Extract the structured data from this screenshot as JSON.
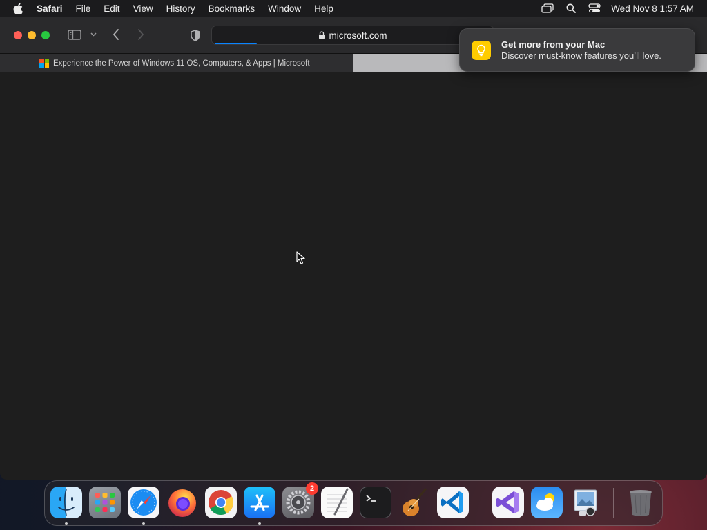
{
  "menubar": {
    "app_name": "Safari",
    "items": [
      "File",
      "Edit",
      "View",
      "History",
      "Bookmarks",
      "Window",
      "Help"
    ],
    "clock": "Wed Nov 8  1:57 AM"
  },
  "browser": {
    "url": "microsoft.com",
    "tab_title": "Experience the Power of Windows 11 OS, Computers, & Apps | Microsoft",
    "load_progress": 0.15
  },
  "notification": {
    "title": "Get more from your Mac",
    "body": "Discover must-know features you’ll love."
  },
  "dock": {
    "apps": [
      {
        "name": "Finder",
        "icon": "finder-icon",
        "running": true
      },
      {
        "name": "Launchpad",
        "icon": "launchpad-icon",
        "running": false
      },
      {
        "name": "Safari",
        "icon": "safari-icon",
        "running": true
      },
      {
        "name": "Firefox",
        "icon": "firefox-icon",
        "running": false
      },
      {
        "name": "Google Chrome",
        "icon": "chrome-icon",
        "running": false
      },
      {
        "name": "App Store",
        "icon": "app-store-icon",
        "running": true
      },
      {
        "name": "System Settings",
        "icon": "system-settings-icon",
        "running": false,
        "badge": "2"
      },
      {
        "name": "TextEdit",
        "icon": "textedit-icon",
        "running": false
      },
      {
        "name": "Terminal",
        "icon": "terminal-icon",
        "running": false
      },
      {
        "name": "GarageBand",
        "icon": "garageband-icon",
        "running": false
      },
      {
        "name": "Visual Studio Code",
        "icon": "vscode-icon",
        "running": false
      },
      {
        "name": "Visual Studio",
        "icon": "visual-studio-icon",
        "running": false
      },
      {
        "name": "Weather",
        "icon": "weather-icon",
        "running": false
      },
      {
        "name": "Preview",
        "icon": "preview-icon",
        "running": false
      },
      {
        "name": "Trash",
        "icon": "trash-icon",
        "running": false
      }
    ]
  },
  "colors": {
    "accent": "#0a84ff",
    "close": "#ff5f57",
    "minimize": "#febc2e",
    "maximize": "#28c840",
    "notification_icon": "#ffcc00",
    "badge": "#ff3b30"
  }
}
